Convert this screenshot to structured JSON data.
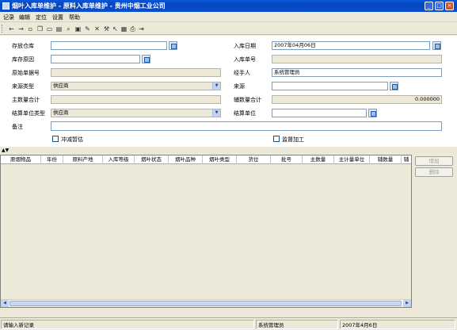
{
  "window": {
    "title": "烟叶入库单维护 - 原料入库单维护 - 贵州中烟工业公司",
    "minimize_label": "_",
    "maximize_label": "□",
    "close_label": "×"
  },
  "menu": [
    "记录",
    "编辑",
    "定位",
    "设置",
    "帮助"
  ],
  "toolbar_icons": [
    "arrow-left-icon",
    "arrow-right-icon",
    "new-icon",
    "copy-icon",
    "folder-icon",
    "open-icon",
    "search-icon",
    "save-icon",
    "edit-icon",
    "delete-icon",
    "tools-icon",
    "pointer-icon",
    "paste-icon",
    "print-icon",
    "exit-icon"
  ],
  "form": {
    "warehouse_label": "存放仓库",
    "warehouse_value": "",
    "storage_date_label": "入库日期",
    "storage_date_value": "2007年04月06日",
    "storage_reason_label": "库存原因",
    "storage_reason_value": "",
    "storage_no_label": "入库单号",
    "storage_no_value": "",
    "source_no_label": "原始单据号",
    "source_no_value": "",
    "handler_label": "经手人",
    "handler_value": "系统管理员",
    "source_type_label": "来源类型",
    "source_type_value": "供应商",
    "source_label": "来源",
    "source_value": "",
    "main_qty_label": "主数量合计",
    "main_qty_value": "",
    "aux_qty_label": "辅数量合计",
    "aux_qty_value": "0.000000",
    "settle_type_label": "结算单位类型",
    "settle_type_value": "供应商",
    "settle_unit_label": "结算单位",
    "settle_unit_value": "",
    "remark_label": "备注",
    "remark_value": "",
    "writeoff_label": "冲减暂估",
    "processing_label": "监督加工"
  },
  "grid": {
    "columns": [
      "原烟物品",
      "年份",
      "原料产地",
      "入库等级",
      "烟叶状态",
      "烟叶品种",
      "烟叶类型",
      "货位",
      "批号",
      "主数量",
      "主计量单位",
      "辅数量",
      "辅"
    ]
  },
  "side_buttons": {
    "add_label": "增加",
    "delete_label": "删除"
  },
  "status": {
    "message": "请输入新记录",
    "user": "系统管理员",
    "date": "2007年4月6日"
  }
}
